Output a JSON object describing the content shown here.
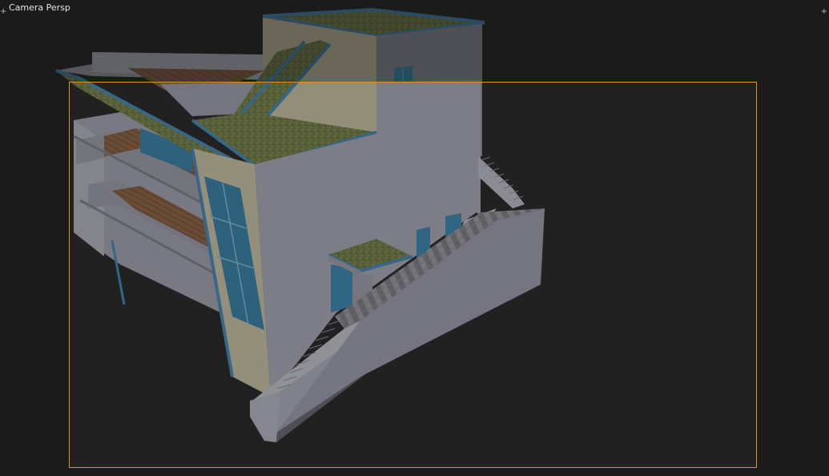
{
  "viewport": {
    "label": "Camera Persp",
    "background": "#1c1c1c",
    "camera_frame_color": "#e0902a",
    "passepartout": "dimmed"
  },
  "scene": {
    "object": "modern-house-model",
    "materials": {
      "wall": "#a7a7b8",
      "wall_warm": "#c8c3a6",
      "trim": "#3f86b8",
      "glass": "#2e7ea8",
      "grass": "#6f7d3f",
      "wood": "#8a5a3c",
      "paving": "#8a8890"
    }
  },
  "icons": {
    "corner_left": "marker-icon",
    "corner_right": "marker-icon"
  }
}
